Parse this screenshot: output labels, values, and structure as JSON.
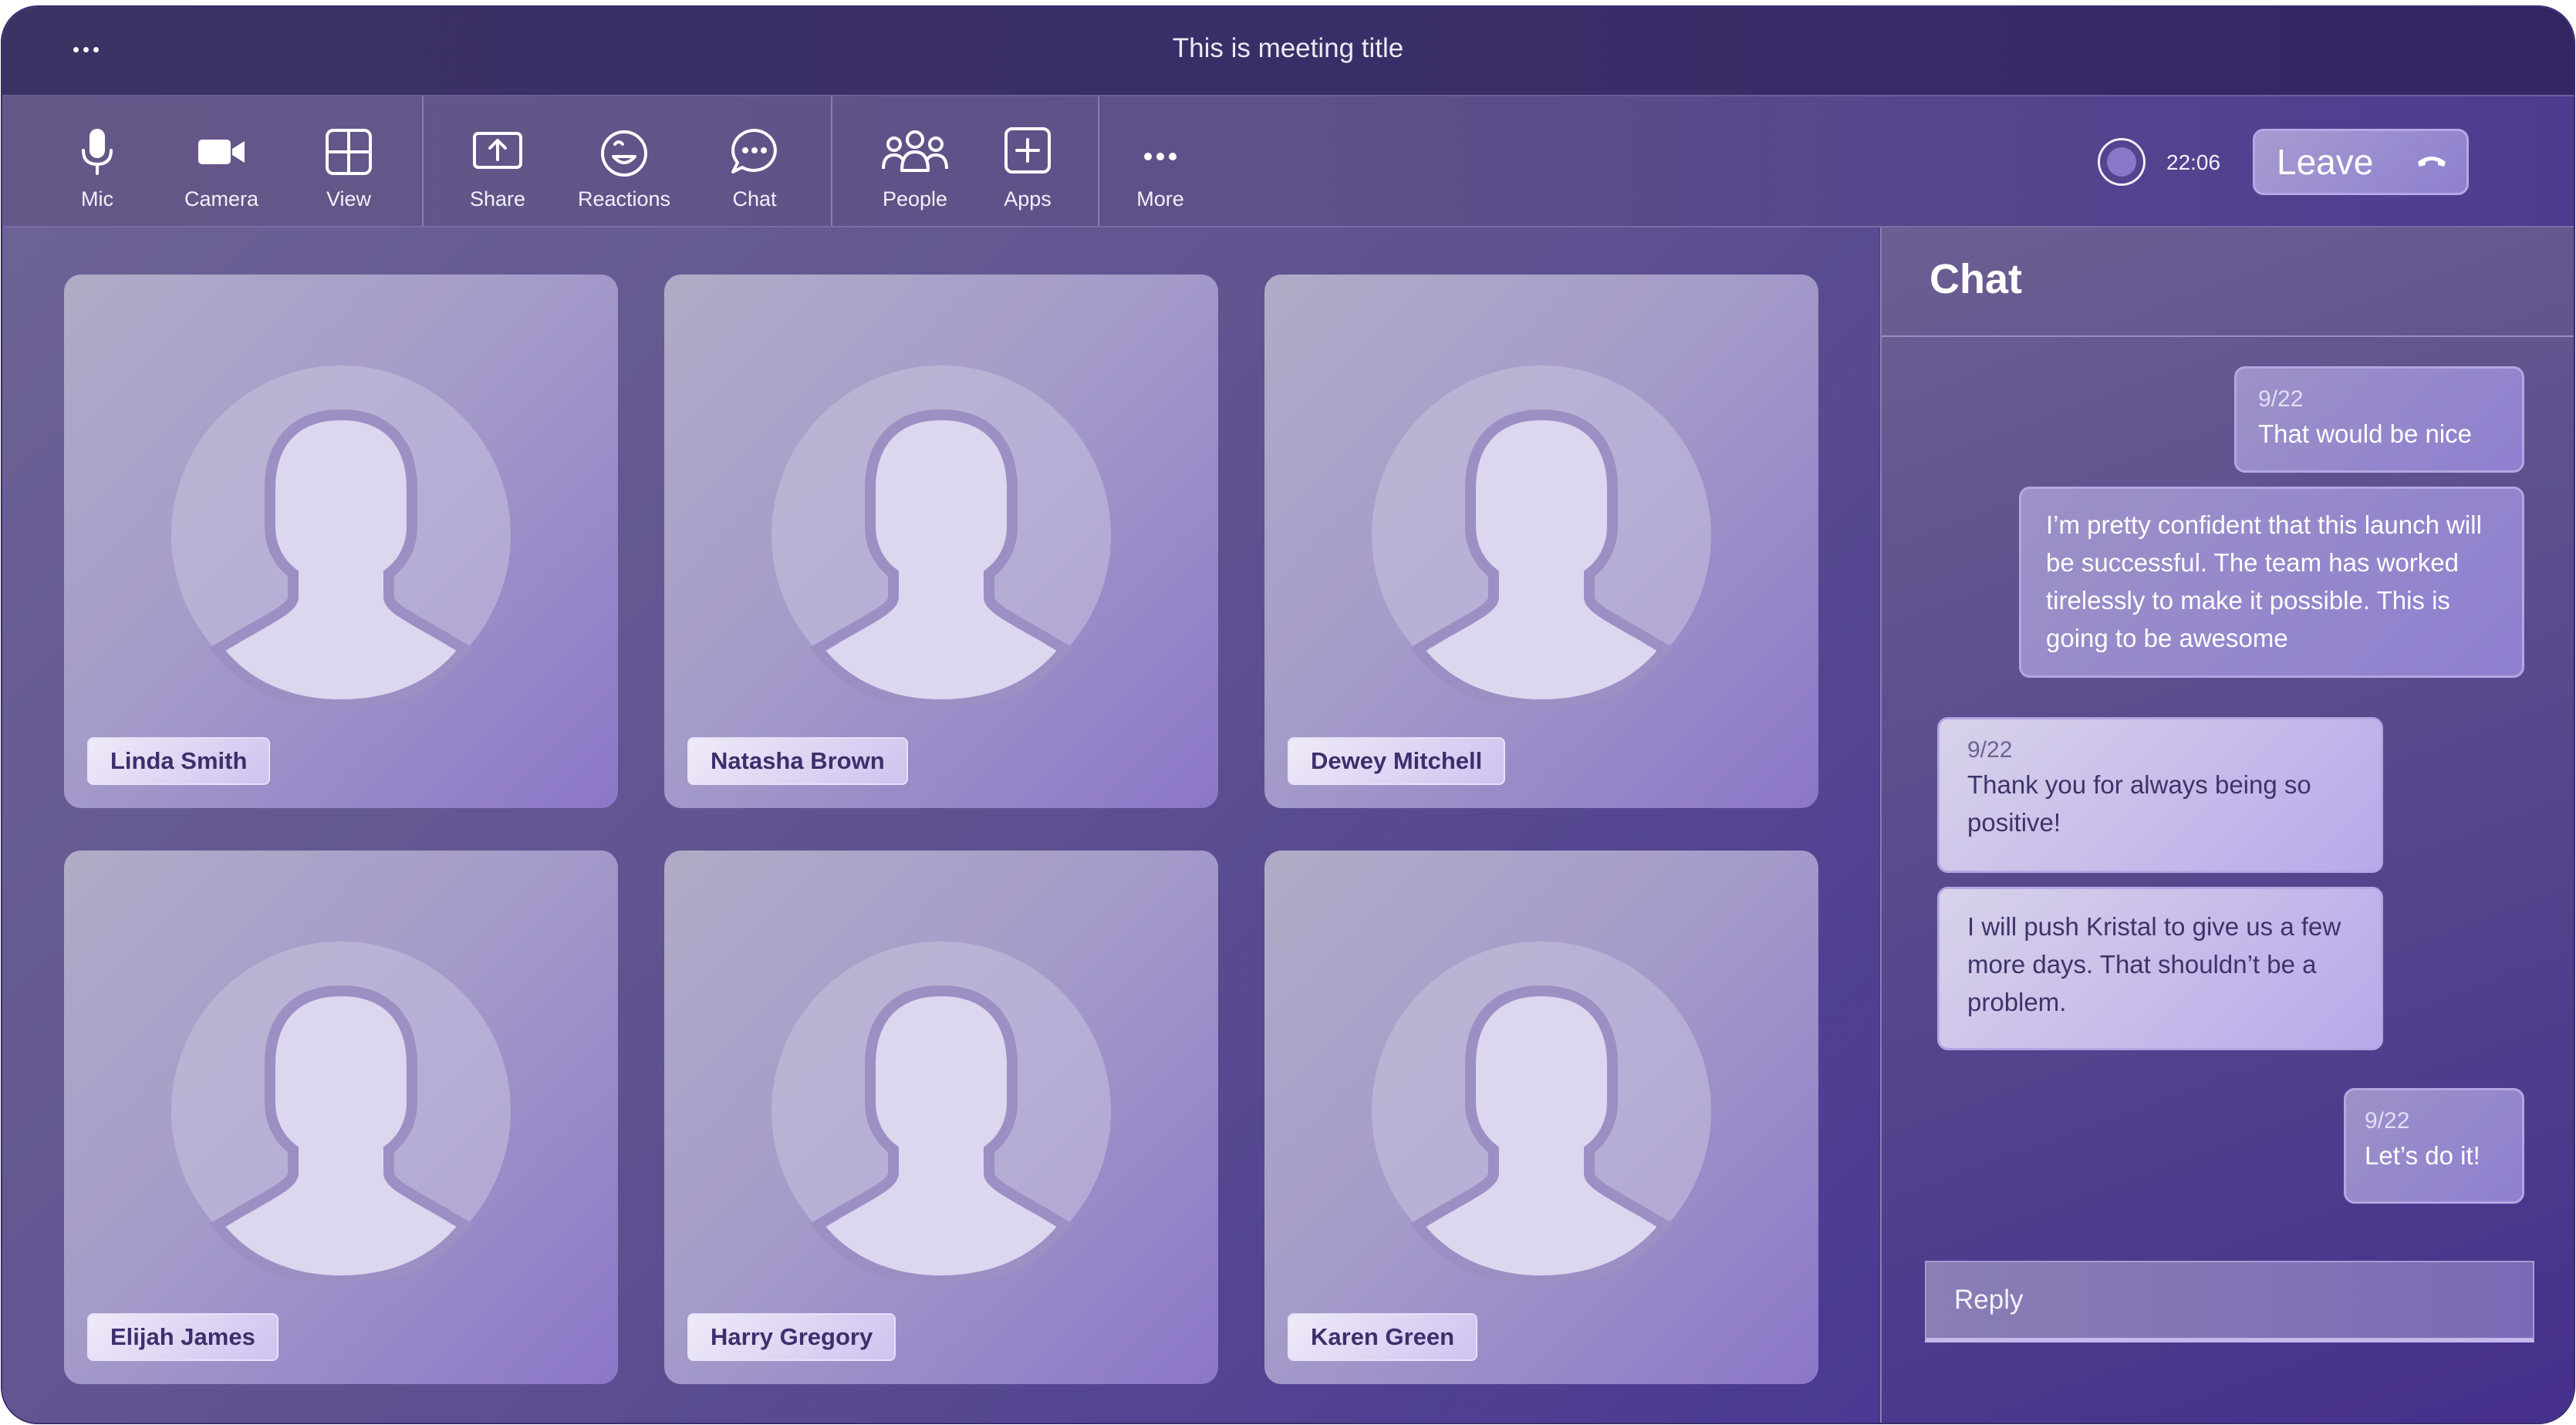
{
  "meeting": {
    "title": "This is meeting title",
    "timer": "22:06",
    "leave_label": "Leave"
  },
  "toolbar": {
    "mic": "Mic",
    "camera": "Camera",
    "view": "View",
    "share": "Share",
    "reactions": "Reactions",
    "chat": "Chat",
    "people": "People",
    "apps": "Apps",
    "more": "More"
  },
  "participants": [
    {
      "name": "Linda Smith"
    },
    {
      "name": "Natasha Brown"
    },
    {
      "name": "Dewey Mitchell"
    },
    {
      "name": "Elijah James"
    },
    {
      "name": "Harry Gregory"
    },
    {
      "name": "Karen Green"
    }
  ],
  "chat": {
    "title": "Chat",
    "messages": [
      {
        "date": "9/22",
        "text": "That would be nice"
      },
      {
        "text": "I’m pretty confident that this launch will be successful. The team has worked tirelessly to make it possible. This is going to be awesome"
      },
      {
        "date": "9/22",
        "text": "Thank you for always being so positive!"
      },
      {
        "text": "I will push Kristal to give us a few more days. That shouldn’t be a problem."
      },
      {
        "date": "9/22",
        "text": "Let’s do it!"
      }
    ],
    "reply_placeholder": "Reply"
  },
  "colors": {
    "accent": "#8f7fd0",
    "background": "#4b3a8e",
    "titlebar": "#3a2d68"
  }
}
